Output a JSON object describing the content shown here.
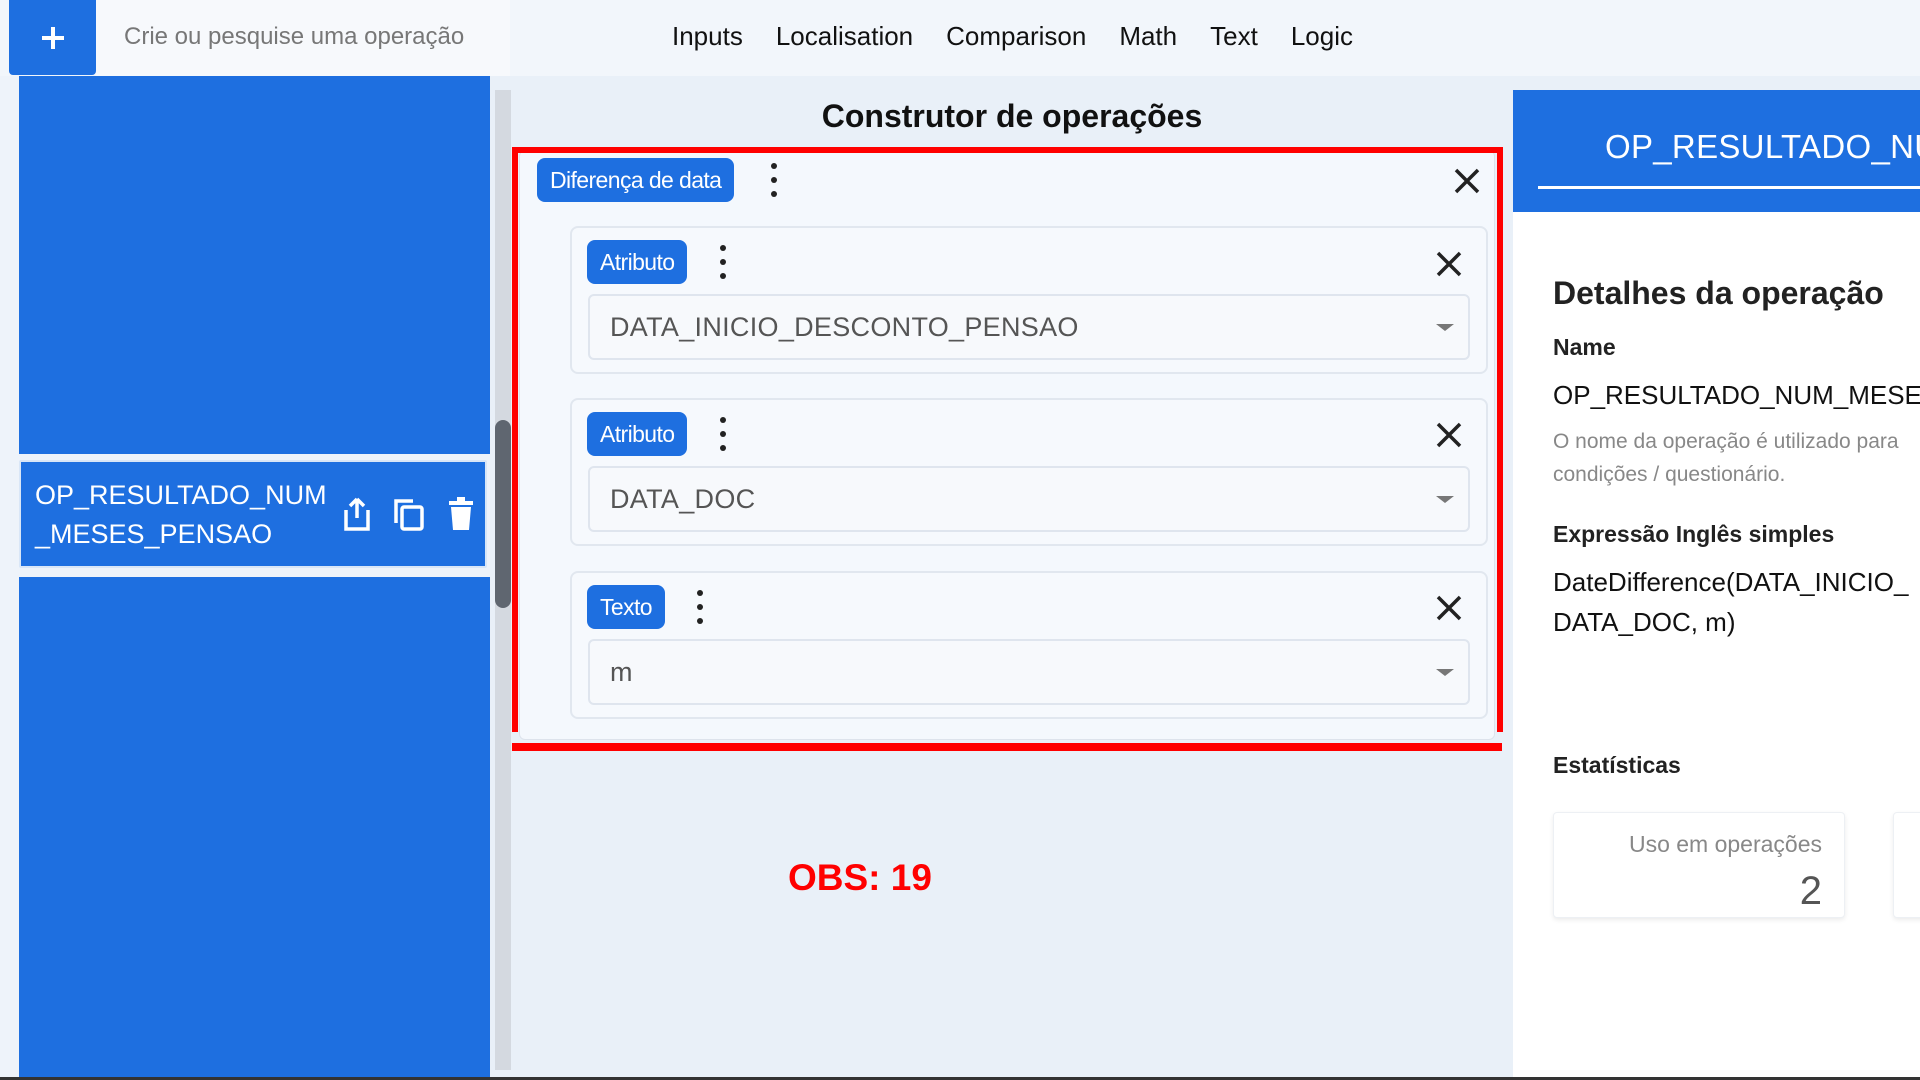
{
  "topbar": {
    "search_placeholder": "Crie ou pesquise uma operação",
    "menu": [
      "Inputs",
      "Localisation",
      "Comparison",
      "Math",
      "Text",
      "Logic"
    ]
  },
  "sidebar": {
    "selected_item": "OP_RESULTADO_NUM_MESES_PENSAO"
  },
  "builder": {
    "title": "Construtor de operações",
    "operation_chip": "Diferença de data",
    "arguments": [
      {
        "type": "Atributo",
        "value": "DATA_INICIO_DESCONTO_PENSAO"
      },
      {
        "type": "Atributo",
        "value": "DATA_DOC"
      },
      {
        "type": "Texto",
        "value": "m"
      }
    ]
  },
  "annotation": "OBS: 19",
  "right_panel": {
    "header_title": "OP_RESULTADO_NU",
    "details_title": "Detalhes da operação",
    "name_label": "Name",
    "name_value": "OP_RESULTADO_NUM_MESE",
    "name_help": "O nome da operação é utilizado para condições / questionário.",
    "expression_label": "Expressão Inglês simples",
    "expression_value": "DateDifference(DATA_INICIO_DATA_DOC, m)",
    "stats_label": "Estatísticas",
    "stat_usage_label": "Uso em operações",
    "stat_usage_value": "2"
  },
  "colors": {
    "accent": "#1e6fe0",
    "highlight": "#ff0000"
  }
}
